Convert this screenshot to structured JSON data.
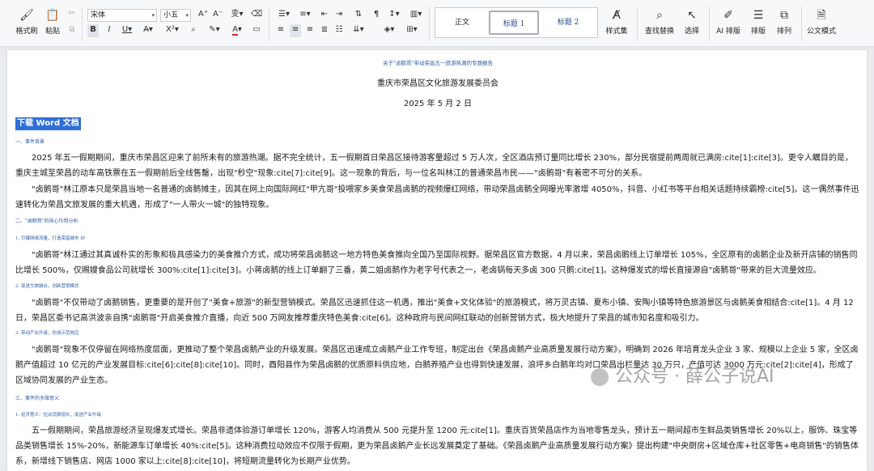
{
  "ribbon": {
    "format_painter": "格式刷",
    "paste": "粘贴",
    "font_name": "宋体",
    "font_size": "小五",
    "style_normal": "正文",
    "style_h1": "标题 1",
    "style_h2": "标题 2",
    "style_set": "样式集",
    "find_replace": "查找替换",
    "select": "选择",
    "ai_layout": "AI 排版",
    "layout": "排版",
    "arrange": "排列",
    "official_mode": "公文模式"
  },
  "doc": {
    "report_title": "关于\"卤鹅哥\"带动荣昌五一旅游热潮的专题报告",
    "org": "重庆市荣昌区文化旅游发展委员会",
    "date": "2025 年 5 月 2 日",
    "download": "下载 Word 文档",
    "sec1": "一、事件背景",
    "p1": "2025 年五一假期期间，重庆市荣昌区迎来了前所未有的旅游热潮。据不完全统计，五一假期首日荣昌区接待游客量超过 5 万人次，全区酒店预订量同比增长 230%，部分民宿提前两周就已满房:cite[1]:cite[3]。更令人瞩目的是，重庆主城至荣昌的动车高铁票在五一假期前后全线售罄，出现\"秒空\"现象:cite[7]:cite[9]。这一现象的背后，与一位名叫林江的普通荣昌市民——\"卤鹅哥\"有着密不可分的关系。",
    "p2": "\"卤鹅哥\"林江原本只是荣昌当地一名普通的卤鹅摊主，因其在网上向国际网红\"甲亢哥\"投喂家乡美食荣昌卤鹅的视频爆红网络，带动荣昌卤鹅全网曝光率激增 4050%，抖音、小红书等平台相关话题持续霸榜:cite[5]。这一偶然事件迅速转化为荣昌文旅发展的重大机遇，形成了\"一人带火一城\"的独特现象。",
    "sec2": "二、\"卤鹅哥\"的核心作用分析",
    "sub1": "1. 引爆网络流量，打造荣昌城市 IP",
    "p3": "\"卤鹅哥\"林江通过其真诚朴实的形象和极具感染力的美食推介方式，成功将荣昌卤鹅这一地方特色美食推向全国乃至国际视野。据荣昌区官方数据，4 月以来，荣昌卤鹅线上订单增长 105%，全区原有的卤鹅企业及新开店铺的销售同比增长 500%，仅赐嫂食品公司就增长 300%:cite[1]:cite[3]。小蒋卤鹅的线上订单翻了三番，黄二姐卤鹅作为老字号代表之一，老卤锅每天多卤 300 只鹅:cite[1]。这种爆发式的增长直接源自\"卤鹅哥\"带来的巨大流量效应。",
    "sub2": "2. 促进文旅融合，创新营销模式",
    "p4": "\"卤鹅哥\"不仅带动了卤鹅销售，更重要的是开创了\"美食+旅游\"的新型营销模式。荣昌区迅速抓住这一机遇，推出\"美食+文化体验\"的旅游模式，将万灵古镇、夏布小镇、安陶小镇等特色旅游景区与卤鹅美食相结合:cite[1]。4 月 12 日，荣昌区委书记高洪波亲自携\"卤鹅哥\"开启美食推介直播，向近 500 万网友推荐重庆特色美食:cite[6]。这种政府与民间网红联动的创新营销方式，极大地提升了荣昌的城市知名度和吸引力。",
    "sub3": "3. 带动产业升级，形成示范效应",
    "p5": "\"卤鹅哥\"现象不仅停留在网络热度层面，更推动了整个荣昌卤鹅产业的升级发展。荣昌区迅速成立卤鹅产业工作专班，制定出台《荣昌卤鹅产业高质量发展行动方案》，明确到 2026 年培育龙头企业 3 家、规模以上企业 5 家，全区卤鹅产值超过 10 亿元的产业发展目标:cite[6]:cite[8]:cite[10]。同时，酉阳县作为荣昌卤鹅的优质原料供应地，白鹅养殖产业也得到快速发展，浪坪乡白鹅年均对口荣昌出栏量达 30 万只，产值可达 3000 万元:cite[2]:cite[4]，形成了区域协同发展的产业生态。",
    "sec3": "三、事件的多维意义",
    "sub4": "1. 经济意义：拉动消费增长，促进产业升级",
    "p6": "五一假期期间，荣昌旅游经济呈现爆发式增长。荣昌非遗体验游订单增长 120%，游客人均消费从 500 元提升至 1200 元:cite[1]。重庆百货荣昌店作为当地零售龙头，预计五一期间超市生鲜品类销售增长 20%以上，服饰、珠宝等品类销售增长 15%-20%，新能源车订单增长 40%:cite[5]。这种消费拉动效应不仅限于假期，更为荣昌卤鹅产业长远发展奠定了基础。《荣昌卤鹅产业高质量发展行动方案》提出构建\"中央厨房+区域仓库+社区零售+电商销售\"的销售体系，新增线下销售店、网店 1000 家以上:cite[8]:cite[10]，将短期流量转化为长期产业优势。",
    "watermark": "公众号 · 薛公子说AI"
  }
}
